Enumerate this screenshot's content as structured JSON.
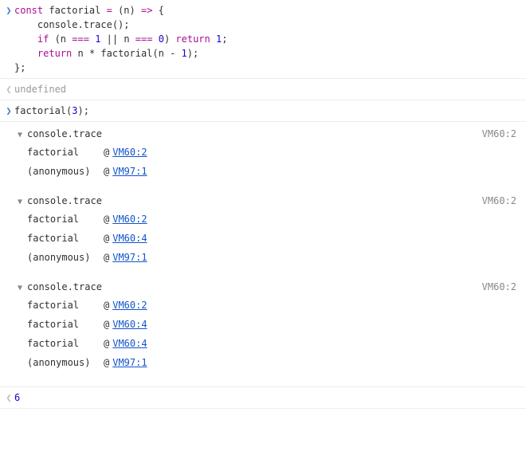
{
  "entries": [
    {
      "kind": "input",
      "marker": "❯",
      "code_html": "<span class='kw'>const</span> factorial <span class='op'>=</span> (n) <span class='op'>=&gt;</span> {\n    console.trace();\n    <span class='kw'>if</span> (n <span class='op'>===</span> <span class='num'>1</span> || n <span class='op'>===</span> <span class='num'>0</span>) <span class='kw'>return</span> <span class='num'>1</span>;\n    <span class='kw'>return</span> n * factorial(n - <span class='num'>1</span>);\n};"
    },
    {
      "kind": "output",
      "marker": "❮",
      "result": {
        "text": "undefined",
        "class": "undef"
      }
    },
    {
      "kind": "input",
      "marker": "❯",
      "code_html": "factorial(<span class='num'>3</span>);"
    },
    {
      "kind": "traces",
      "groups": [
        {
          "title": "console.trace",
          "source": "VM60:2",
          "frames": [
            {
              "fn": "factorial",
              "at": "@",
              "loc": "VM60:2"
            },
            {
              "fn": "(anonymous)",
              "at": "@",
              "loc": "VM97:1"
            }
          ]
        },
        {
          "title": "console.trace",
          "source": "VM60:2",
          "frames": [
            {
              "fn": "factorial",
              "at": "@",
              "loc": "VM60:2"
            },
            {
              "fn": "factorial",
              "at": "@",
              "loc": "VM60:4"
            },
            {
              "fn": "(anonymous)",
              "at": "@",
              "loc": "VM97:1"
            }
          ]
        },
        {
          "title": "console.trace",
          "source": "VM60:2",
          "frames": [
            {
              "fn": "factorial",
              "at": "@",
              "loc": "VM60:2"
            },
            {
              "fn": "factorial",
              "at": "@",
              "loc": "VM60:4"
            },
            {
              "fn": "factorial",
              "at": "@",
              "loc": "VM60:4"
            },
            {
              "fn": "(anonymous)",
              "at": "@",
              "loc": "VM97:1"
            }
          ]
        }
      ]
    },
    {
      "kind": "output",
      "marker": "❮",
      "result": {
        "text": "6",
        "class": "resnum"
      }
    }
  ],
  "glyphs": {
    "disclose_open": "▼"
  }
}
